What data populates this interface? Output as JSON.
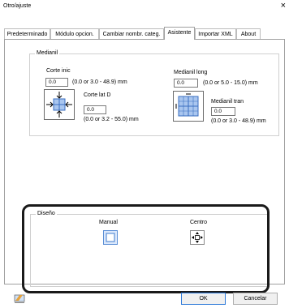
{
  "window": {
    "title": "Otro/ajuste",
    "close_glyph": "×"
  },
  "tabs": [
    {
      "label": "Predeterminado"
    },
    {
      "label": "Módulo opcion."
    },
    {
      "label": "Cambiar nombr. categ."
    },
    {
      "label": "Asistente",
      "active": true
    },
    {
      "label": "Importar XML"
    },
    {
      "label": "About"
    }
  ],
  "medianil": {
    "title": "Medianil",
    "corte_inic": {
      "label": "Corte inic",
      "value": "0.0",
      "range": "(0.0 or 3.0 - 48.9) mm"
    },
    "corte_lat_d": {
      "label": "Corte lat D",
      "value": "0.0",
      "range": "(0.0 or 3.2 - 55.0) mm"
    },
    "medianil_long": {
      "label": "Medianil long",
      "value": "0.0",
      "range": "(0.0 or 5.0 - 15.0) mm"
    },
    "medianil_tran": {
      "label": "Medianil tran",
      "value": "0.0",
      "range": "(0.0 or 3.0 - 48.9) mm"
    }
  },
  "diseno": {
    "title": "Diseño",
    "manual_label": "Manual",
    "centro_label": "Centro"
  },
  "footer": {
    "ok_label": "OK",
    "cancel_label": "Cancelar"
  },
  "colors": {
    "diagram_blue": "#5b8fd6",
    "highlight": "#1a1a1a",
    "ok_border": "#2b78d8"
  },
  "icons": [
    "close-icon",
    "corte-diagram-icon",
    "medianil-diagram-icon",
    "manual-layout-icon",
    "centro-layout-icon",
    "eraser-icon"
  ]
}
